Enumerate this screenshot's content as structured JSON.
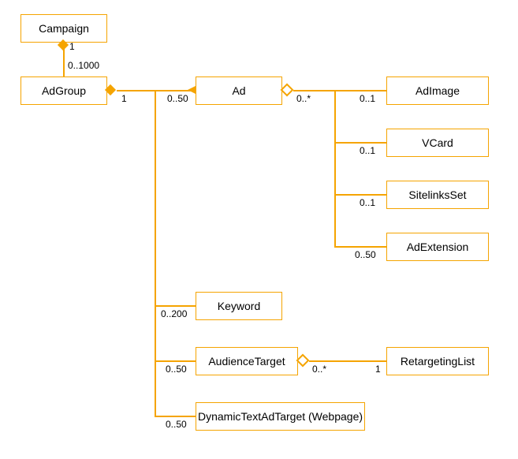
{
  "entities": {
    "campaign": "Campaign",
    "adgroup": "AdGroup",
    "ad": "Ad",
    "adimage": "AdImage",
    "vcard": "VCard",
    "sitelinksset": "SitelinksSet",
    "adextension": "AdExtension",
    "keyword": "Keyword",
    "audiencetarget": "AudienceTarget",
    "retargetinglist": "RetargetingList",
    "dynamictextadtarget": "DynamicTextAdTarget (Webpage)"
  },
  "multiplicities": {
    "campaign_to_adgroup_parent": "1",
    "campaign_to_adgroup_child": "0..1000",
    "adgroup_to_ad_parent": "1",
    "adgroup_to_ad_child": "0..50",
    "ad_to_adimage_parent": "0..*",
    "ad_to_adimage_child": "0..1",
    "ad_to_vcard_child": "0..1",
    "ad_to_sitelinksset_child": "0..1",
    "ad_to_adextension_child": "0..50",
    "adgroup_to_keyword_child": "0..200",
    "adgroup_to_audiencetarget_child": "0..50",
    "audiencetarget_to_retargetinglist_parent": "0..*",
    "audiencetarget_to_retargetinglist_child": "1",
    "adgroup_to_dynamictextadtarget_child": "0..50"
  }
}
